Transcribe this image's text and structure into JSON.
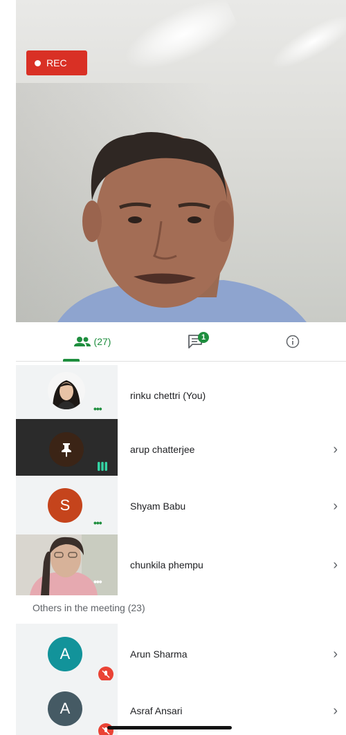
{
  "video": {
    "rec_label": "REC"
  },
  "tabs": {
    "people_count": "(27)",
    "chat_badge": "1"
  },
  "participants": [
    {
      "name": "rinku chettri (You)"
    },
    {
      "name": "arup chatterjee"
    },
    {
      "name": "Shyam Babu",
      "initial": "S"
    },
    {
      "name": "chunkila phempu"
    }
  ],
  "others": {
    "label": "Others in the meeting (23)",
    "items": [
      {
        "name": "Arun Sharma",
        "initial": "A"
      },
      {
        "name": "Asraf Ansari",
        "initial": "A"
      }
    ]
  },
  "colors": {
    "accent": "#1e8e3e",
    "rec": "#d93025",
    "mute": "#ea4335",
    "avatar_shyam": "#c5441c",
    "avatar_arun": "#12939a",
    "avatar_asraf": "#455a64"
  }
}
